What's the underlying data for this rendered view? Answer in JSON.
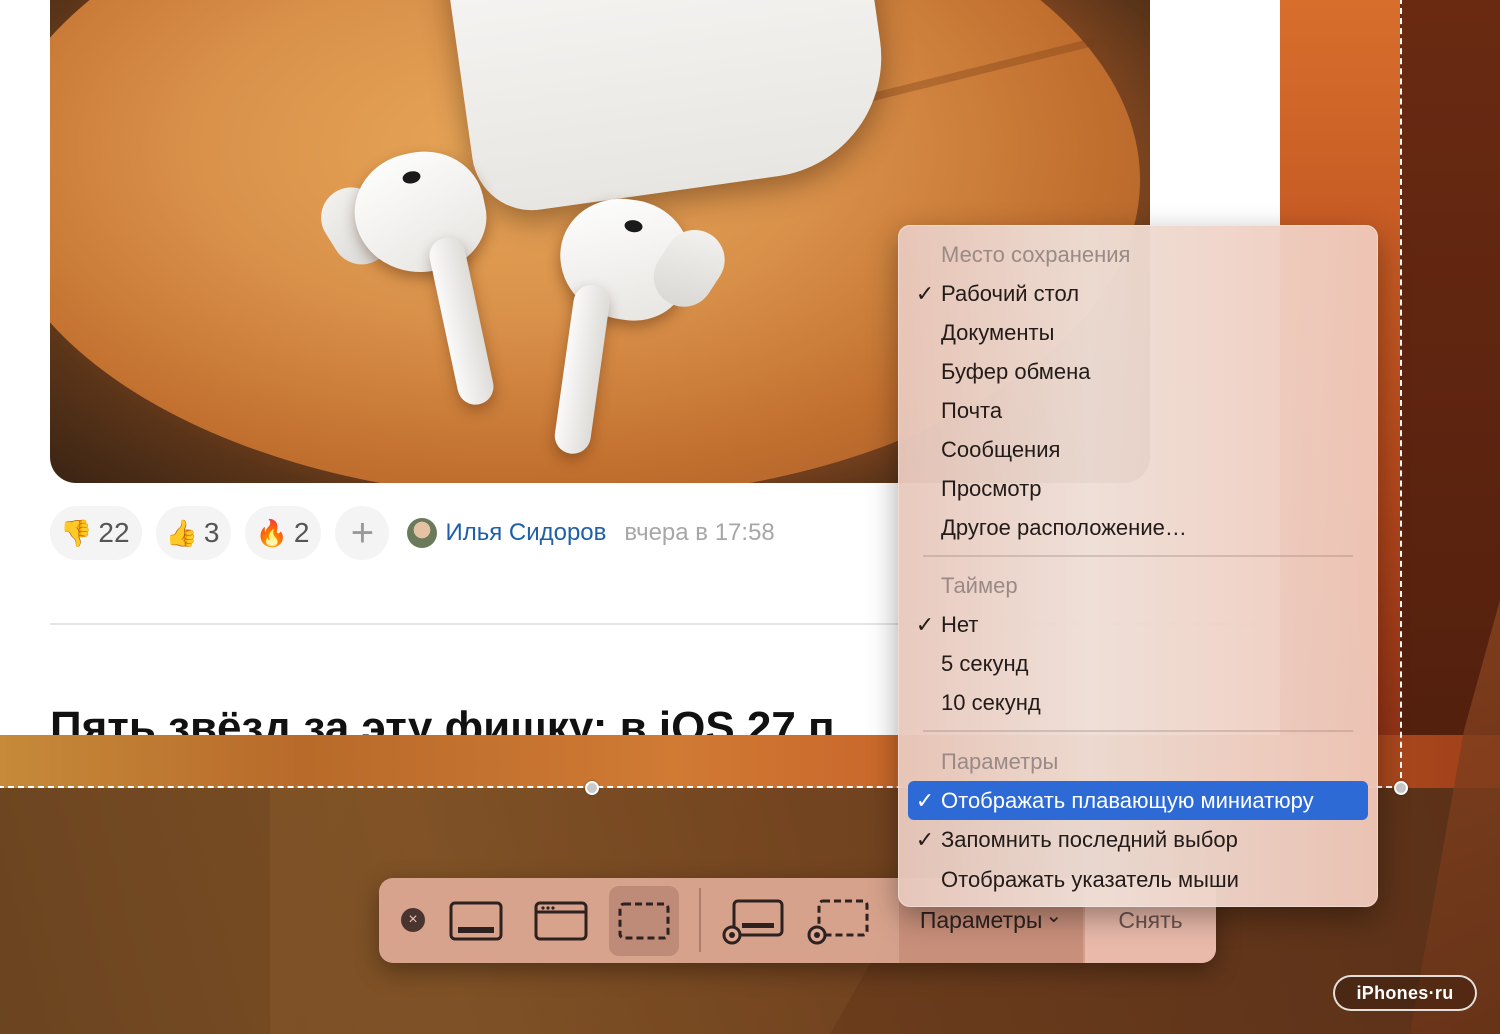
{
  "article": {
    "reactions": [
      {
        "emoji": "👎",
        "count": "22"
      },
      {
        "emoji": "👍",
        "count": "3"
      },
      {
        "emoji": "🔥",
        "count": "2"
      }
    ],
    "add_reaction_symbol": "+",
    "author": "Илья Сидоров",
    "timestamp": "вчера в 17:58",
    "next_headline": "Пять звёзд за эту фишку: в iOS 27 п"
  },
  "menu": {
    "sections": [
      {
        "title": "Место сохранения",
        "items": [
          {
            "label": "Рабочий стол",
            "checked": true
          },
          {
            "label": "Документы",
            "checked": false
          },
          {
            "label": "Буфер обмена",
            "checked": false
          },
          {
            "label": "Почта",
            "checked": false
          },
          {
            "label": "Сообщения",
            "checked": false
          },
          {
            "label": "Просмотр",
            "checked": false
          },
          {
            "label": "Другое расположение…",
            "checked": false
          }
        ]
      },
      {
        "title": "Таймер",
        "items": [
          {
            "label": "Нет",
            "checked": true
          },
          {
            "label": "5 секунд",
            "checked": false
          },
          {
            "label": "10 секунд",
            "checked": false
          }
        ]
      },
      {
        "title": "Параметры",
        "items": [
          {
            "label": "Отображать плавающую миниатюру",
            "checked": true,
            "highlighted": true
          },
          {
            "label": "Запомнить последний выбор",
            "checked": true
          },
          {
            "label": "Отображать указатель мыши",
            "checked": false
          }
        ]
      }
    ],
    "check_glyph": "✓"
  },
  "toolbar": {
    "close_glyph": "×",
    "tools": [
      {
        "name": "capture-entire-screen-icon",
        "active": false
      },
      {
        "name": "capture-selected-window-icon",
        "active": false
      },
      {
        "name": "capture-selected-portion-icon",
        "active": true
      },
      {
        "name": "record-entire-screen-icon",
        "active": false
      },
      {
        "name": "record-selected-portion-icon",
        "active": false
      }
    ],
    "options_label": "Параметры",
    "options_chevron": "⌄",
    "capture_label": "Снять"
  },
  "watermark": "iPhones·ru",
  "colors": {
    "menu_highlight": "#2d6ad6",
    "author_link": "#1f5fa8"
  }
}
